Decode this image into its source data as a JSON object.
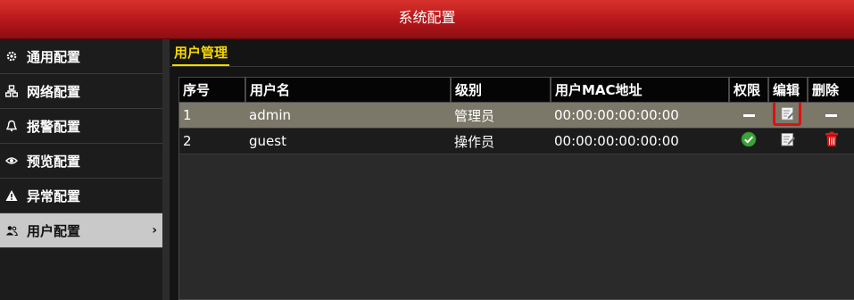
{
  "window": {
    "title": "系统配置"
  },
  "sidebar": {
    "items": [
      {
        "label": "通用配置",
        "icon": "gear-icon",
        "active": false
      },
      {
        "label": "网络配置",
        "icon": "network-icon",
        "active": false
      },
      {
        "label": "报警配置",
        "icon": "alarm-icon",
        "active": false
      },
      {
        "label": "预览配置",
        "icon": "eye-icon",
        "active": false
      },
      {
        "label": "异常配置",
        "icon": "warning-icon",
        "active": false
      },
      {
        "label": "用户配置",
        "icon": "users-icon",
        "active": true,
        "chevron": "›"
      }
    ]
  },
  "main": {
    "tab": "用户管理",
    "table": {
      "headers": [
        "序号",
        "用户名",
        "级别",
        "用户MAC地址",
        "权限",
        "编辑",
        "删除"
      ],
      "rows": [
        {
          "index": "1",
          "username": "admin",
          "level": "管理员",
          "mac": "00:00:00:00:00:00",
          "permission": "none",
          "edit": "edit-icon",
          "delete": "none"
        },
        {
          "index": "2",
          "username": "guest",
          "level": "操作员",
          "mac": "00:00:00:00:00:00",
          "permission": "check-icon",
          "edit": "edit-icon",
          "delete": "trash-icon"
        }
      ]
    }
  },
  "colors": {
    "title_bar": "#c21d20",
    "tab_accent": "#f5d800",
    "selected_row": "#7b7869",
    "check_green": "#3aa33a",
    "delete_red": "#d81b1b",
    "highlight_red": "#e01010"
  }
}
